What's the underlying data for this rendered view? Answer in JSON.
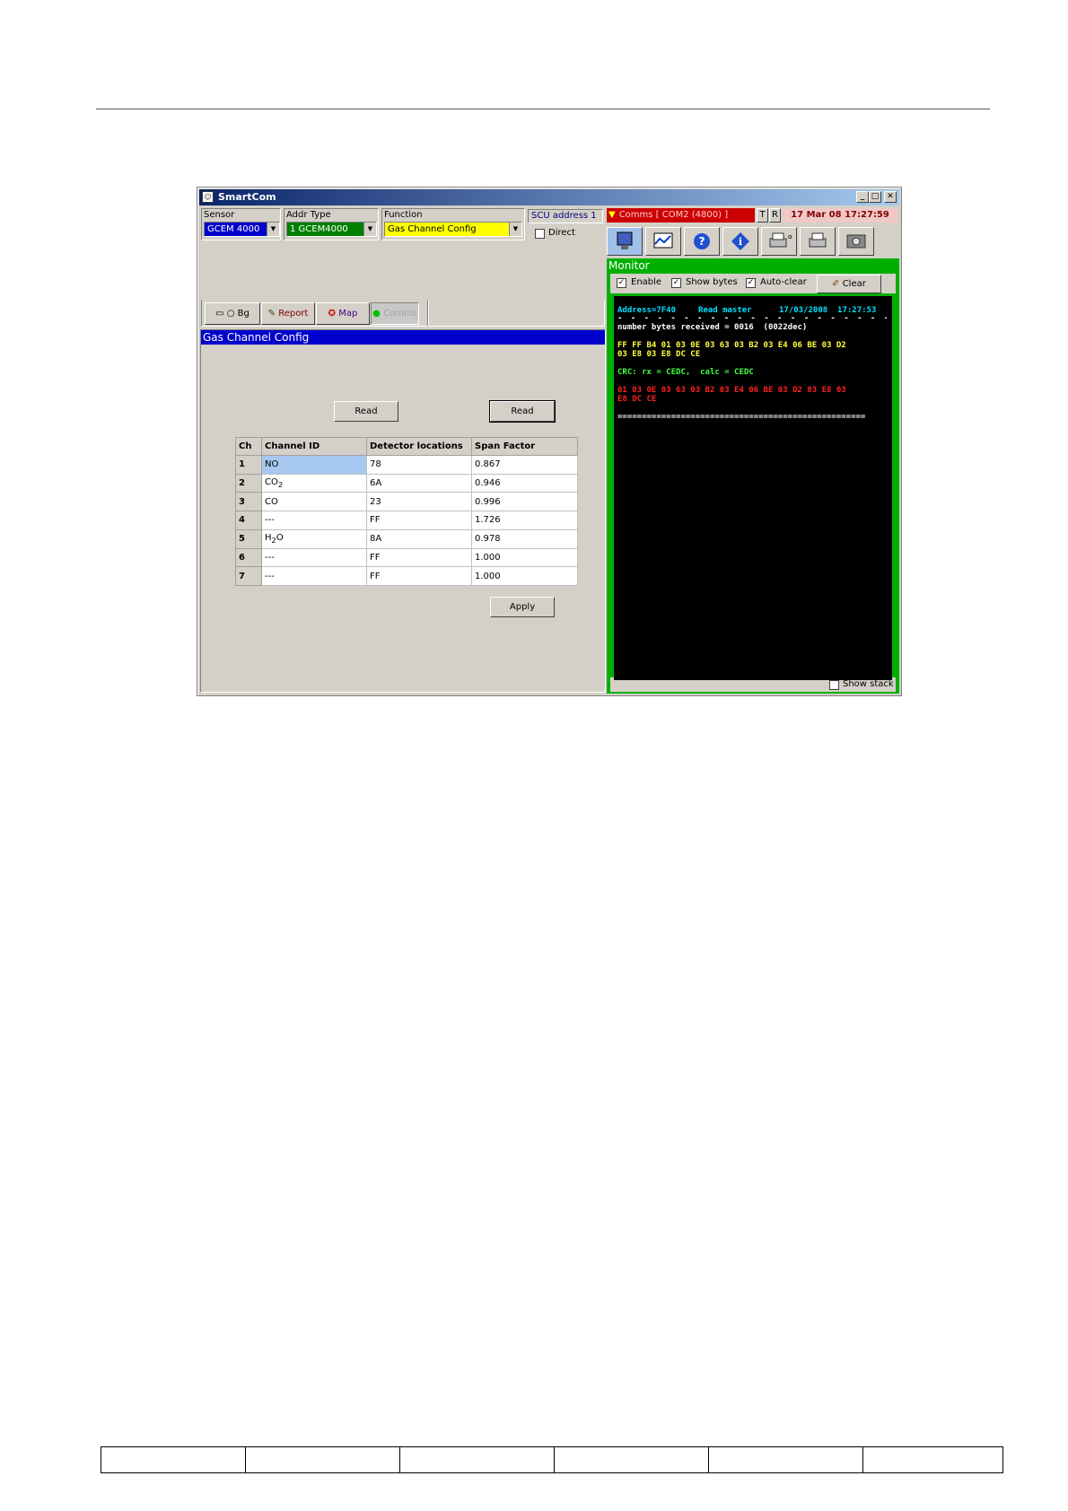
{
  "window": {
    "title": "SmartCom",
    "buttons": {
      "minimize": "_",
      "maximize": "□",
      "close": "✕"
    }
  },
  "sensor": {
    "label": "Sensor",
    "value": "GCEM 4000"
  },
  "addr_type": {
    "label": "Addr  Type",
    "value": "1  GCEM4000"
  },
  "function": {
    "label": "Function",
    "value": "Gas Channel Config"
  },
  "scu": {
    "label": "SCU address 1",
    "direct_label": "Direct"
  },
  "left_toolbar": {
    "bg_label": "Bg",
    "report_label": "Report",
    "map_label": "Map",
    "comms_label": "Comms"
  },
  "config_panel": {
    "title": "Gas Channel Config",
    "read_left_label": "Read",
    "read_right_label": "Read",
    "apply_label": "Apply",
    "columns": [
      "Ch",
      "Channel ID",
      "Detector locations",
      "Span Factor"
    ],
    "rows": [
      {
        "ch": "1",
        "id": "NO",
        "sub": "",
        "tail": "",
        "loc": "78",
        "span": "0.867"
      },
      {
        "ch": "2",
        "id": "CO",
        "sub": "2",
        "tail": "",
        "loc": "6A",
        "span": "0.946"
      },
      {
        "ch": "3",
        "id": "CO",
        "sub": "",
        "tail": "",
        "loc": "23",
        "span": "0.996"
      },
      {
        "ch": "4",
        "id": "---",
        "sub": "",
        "tail": "",
        "loc": "FF",
        "span": "1.726"
      },
      {
        "ch": "5",
        "id": "H",
        "sub": "2",
        "tail": "O",
        "loc": "8A",
        "span": "0.978"
      },
      {
        "ch": "6",
        "id": "---",
        "sub": "",
        "tail": "",
        "loc": "FF",
        "span": "1.000"
      },
      {
        "ch": "7",
        "id": "---",
        "sub": "",
        "tail": "",
        "loc": "FF",
        "span": "1.000"
      }
    ]
  },
  "comms": {
    "status": "Comms [ COM2 (4800) ]",
    "t_label": "T",
    "r_label": "R",
    "datetime": "17 Mar 08  17:27:59",
    "icons": [
      "monitor-icon",
      "chart-icon",
      "help-icon",
      "info-icon",
      "printer-settings-icon",
      "printer-icon",
      "camera-icon"
    ]
  },
  "monitor": {
    "title": "Monitor",
    "enable_label": "Enable",
    "show_bytes_label": "Show bytes",
    "auto_clear_label": "Auto-clear",
    "clear_label": "Clear",
    "show_stack_label": "Show stack",
    "lines": {
      "address": "Address=7F40",
      "read_master": "Read master",
      "timestamp": "17/03/2008  17:27:53",
      "bytes_received": "number bytes received = 0016  (0022dec)",
      "hex1": "FF FF B4 01 03 0E 03 63 03 B2 03 E4 06 BE 03 D2",
      "hex2": "03 E8 03 E8 DC CE",
      "crc": "CRC: rx = CEDC,  calc = CEDC",
      "red1": "01 03 0E 03 63 03 B2 03 E4 06 BE 03 D2 03 E8 03",
      "red2": "E8 DC CE",
      "separator": "==================================================="
    }
  },
  "colors": {
    "sensor_bg": "#0000cc",
    "type_bg": "#008000",
    "function_bg": "#ffff00",
    "status_red": "#cc0000",
    "monitor_green": "#00b000",
    "cyan": "#00e0ff",
    "yellow": "#ffff40",
    "green": "#40ff40",
    "red": "#ff2020"
  }
}
